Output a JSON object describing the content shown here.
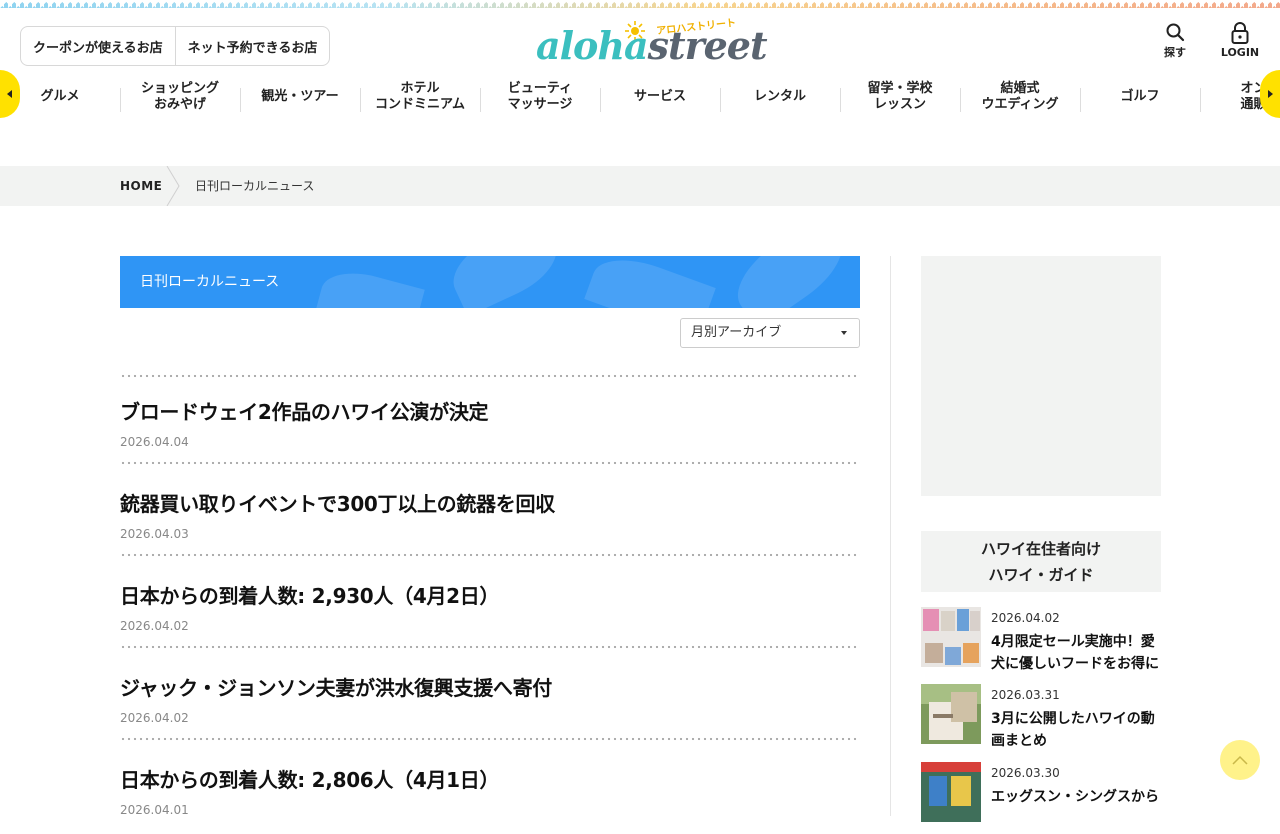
{
  "header": {
    "pill_buttons": [
      "クーポンが使えるお店",
      "ネット予約できるお店"
    ],
    "logo_main_a": "aloha",
    "logo_main_b": "street",
    "logo_sub": "アロハストリート",
    "search_label": "探す",
    "login_label": "LOGIN"
  },
  "gnav": [
    {
      "label": "グルメ"
    },
    {
      "label": "ショッピング\nおみやげ"
    },
    {
      "label": "観光・ツアー"
    },
    {
      "label": "ホテル\nコンドミニアム"
    },
    {
      "label": "ビューティ\nマッサージ"
    },
    {
      "label": "サービス"
    },
    {
      "label": "レンタル"
    },
    {
      "label": "留学・学校\nレッスン"
    },
    {
      "label": "結婚式\nウエディング"
    },
    {
      "label": "ゴルフ"
    },
    {
      "label": "オンラ\n通販・"
    }
  ],
  "breadcrumb": {
    "home": "HOME",
    "current": "日刊ローカルニュース"
  },
  "main": {
    "banner_title": "日刊ローカルニュース",
    "archive_select": "月別アーカイブ",
    "articles": [
      {
        "title": "ブロードウェイ2作品のハワイ公演が決定",
        "date": "2026.04.04"
      },
      {
        "title": "銃器買い取りイベントで300丁以上の銃器を回収",
        "date": "2026.04.03"
      },
      {
        "title": "日本からの到着人数: 2,930人（4月2日）",
        "date": "2026.04.02"
      },
      {
        "title": "ジャック・ジョンソン夫妻が洪水復興支援へ寄付",
        "date": "2026.04.02"
      },
      {
        "title": "日本からの到着人数: 2,806人（4月1日）",
        "date": "2026.04.01"
      }
    ]
  },
  "sidebar": {
    "guide_title_1": "ハワイ在住者向け",
    "guide_title_2": "ハワイ・ガイド",
    "items": [
      {
        "date": "2026.04.02",
        "title": "4月限定セール実施中！愛犬に優しいフードをお得に"
      },
      {
        "date": "2026.03.31",
        "title": "3月に公開したハワイの動画まとめ"
      },
      {
        "date": "2026.03.30",
        "title": "エッグスン・シングスから"
      }
    ]
  },
  "colors": {
    "accent_yellow": "#ffe100",
    "banner_blue": "#2f95f5",
    "logo_teal": "#3bbfbf"
  },
  "icons": {
    "search": "search-icon",
    "login": "lock-icon",
    "to_top": "chevron-up-icon"
  }
}
